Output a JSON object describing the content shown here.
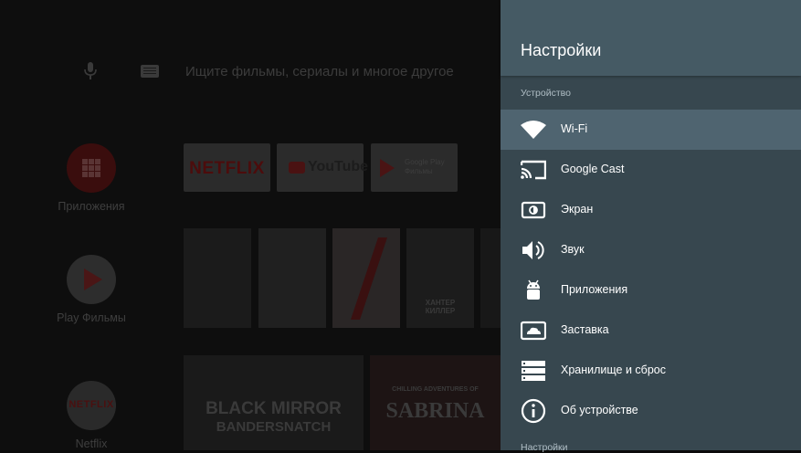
{
  "home": {
    "search_placeholder": "Ищите фильмы, сериалы и многое другое",
    "side_apps": [
      {
        "label": "Приложения"
      },
      {
        "label": "Play Фильмы"
      },
      {
        "label": "Netflix"
      }
    ],
    "app_tiles": {
      "netflix": "NETFLIX",
      "youtube": "YouTube",
      "gplay_line1": "Google Play",
      "gplay_line2": "Фильмы"
    },
    "netflix_mini": "NETFLIX",
    "posters": [
      "",
      "",
      "",
      "ХАНТЕР КИЛЛЕР",
      ""
    ],
    "banners": {
      "black_mirror_1": "BLACK MIRROR",
      "black_mirror_2": "BANDERSNATCH",
      "sabrina_1": "CHILLING ADVENTURES OF",
      "sabrina_2": "SABRINA"
    }
  },
  "settings": {
    "title": "Настройки",
    "section_device": "Устройство",
    "items": [
      {
        "label": "Wi-Fi",
        "icon": "wifi-icon",
        "focused": true
      },
      {
        "label": "Google Cast",
        "icon": "cast-icon"
      },
      {
        "label": "Экран",
        "icon": "display-icon"
      },
      {
        "label": "Звук",
        "icon": "volume-icon"
      },
      {
        "label": "Приложения",
        "icon": "android-icon"
      },
      {
        "label": "Заставка",
        "icon": "screensaver-icon"
      },
      {
        "label": "Хранилище и сброс",
        "icon": "storage-icon"
      },
      {
        "label": "Об устройстве",
        "icon": "info-icon"
      }
    ],
    "section_settings": "Настройки"
  },
  "colors": {
    "panel_bg": "#37474f",
    "panel_header": "#455a64",
    "focused_item": "#4f6470",
    "home_bg": "#0e0e0e"
  }
}
